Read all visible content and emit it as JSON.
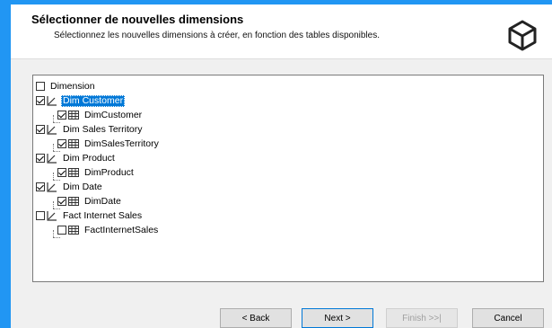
{
  "header": {
    "title": "Sélectionner de nouvelles dimensions",
    "subtitle": "Sélectionnez les nouvelles dimensions à créer, en fonction des tables disponibles.",
    "logo_icon": "cube-icon"
  },
  "tree": {
    "root_label": "Dimension",
    "nodes": [
      {
        "label": "Dim Customer",
        "checked": true,
        "selected": true,
        "child": {
          "label": "DimCustomer",
          "checked": true
        }
      },
      {
        "label": "Dim Sales Territory",
        "checked": true,
        "selected": false,
        "child": {
          "label": "DimSalesTerritory",
          "checked": true
        }
      },
      {
        "label": "Dim Product",
        "checked": true,
        "selected": false,
        "child": {
          "label": "DimProduct",
          "checked": true
        }
      },
      {
        "label": "Dim Date",
        "checked": true,
        "selected": false,
        "child": {
          "label": "DimDate",
          "checked": true
        }
      },
      {
        "label": "Fact Internet Sales",
        "checked": false,
        "selected": false,
        "child": {
          "label": "FactInternetSales",
          "checked": false
        }
      }
    ]
  },
  "buttons": {
    "back": "< Back",
    "next": "Next >",
    "finish": "Finish >>|",
    "cancel": "Cancel"
  },
  "colors": {
    "selection": "#0078d7",
    "desktop_blue": "#1e88e5"
  }
}
